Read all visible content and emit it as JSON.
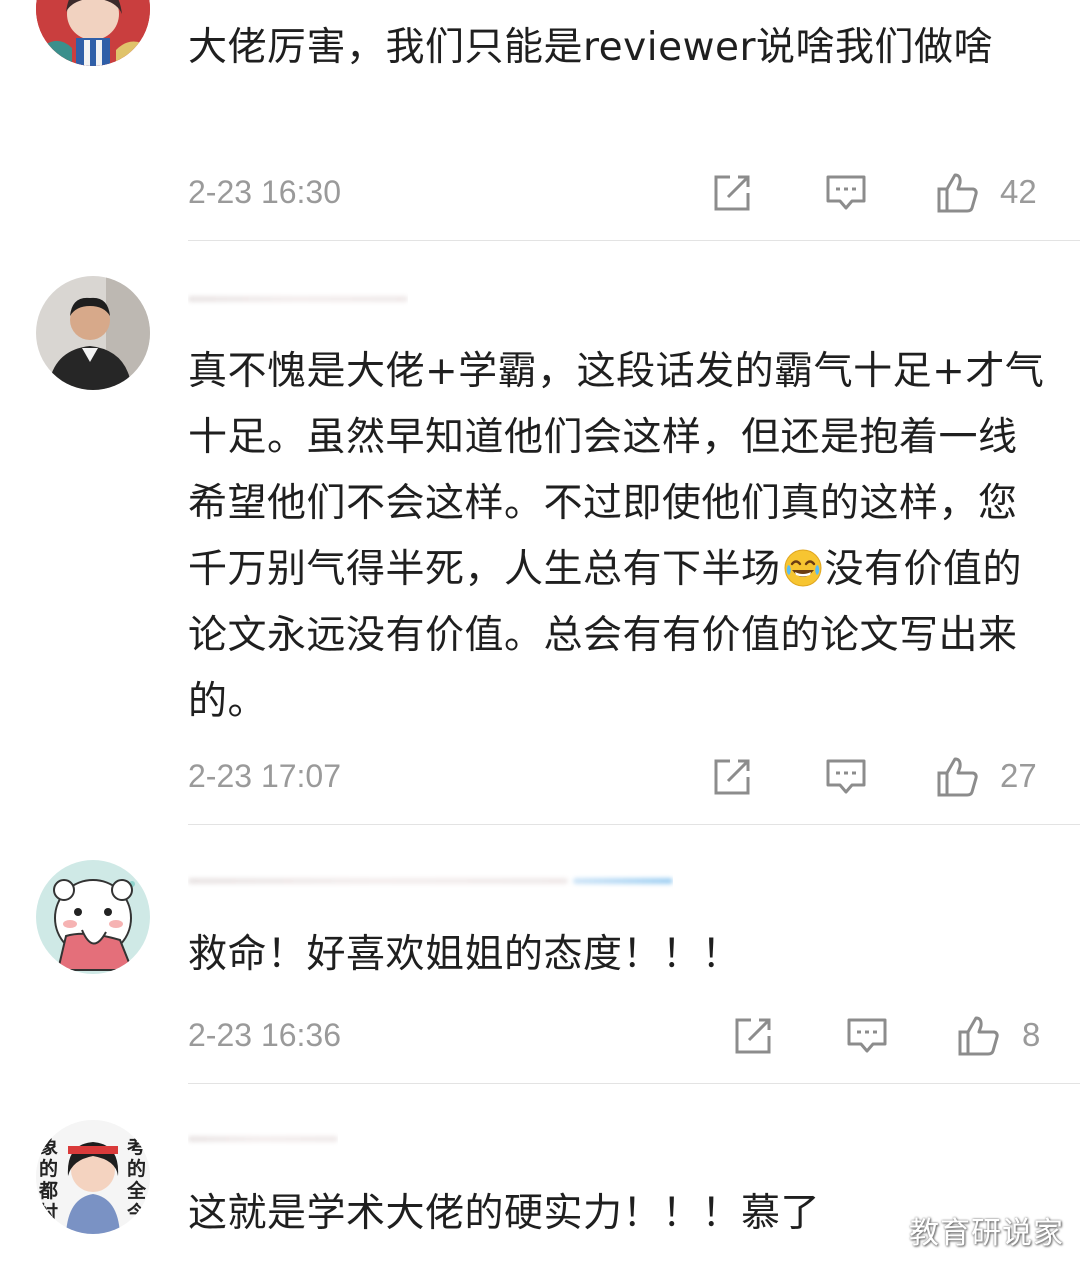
{
  "comments": [
    {
      "username": "",
      "text": "大佬厉害，我们只能是reviewer说啥我们做啥",
      "time": "2-23 16:30",
      "likes": "42"
    },
    {
      "username": "",
      "text_part1": "真不愧是大佬+学霸，这段话发的霸气十足+才气十足。虽然早知道他们会这样，但还是抱着一线希望他们不会这样。不过即使他们真的这样，您千万别气得半死，人生总有下半场",
      "text_part2": "没有价值的论文永远没有价值。总会有有价值的论文写出来的。",
      "time": "2-23 17:07",
      "likes": "27"
    },
    {
      "username": "",
      "text": "救命！好喜欢姐姐的态度！！！",
      "time": "2-23 16:36",
      "likes": "8"
    },
    {
      "username": "",
      "text": "这就是学术大佬的硬实力！！！慕了",
      "avatar_text_left": "象的都忖",
      "avatar_text_right": "考的全今"
    }
  ],
  "icons": {
    "share": "share-icon",
    "reply": "reply-icon",
    "like": "thumbs-up-icon",
    "emoji": "laughing-tears-emoji"
  },
  "watermark": "教育研说家",
  "colors": {
    "text": "#1f1f1f",
    "meta": "#9a9a9a",
    "divider": "#e3e3e3"
  }
}
